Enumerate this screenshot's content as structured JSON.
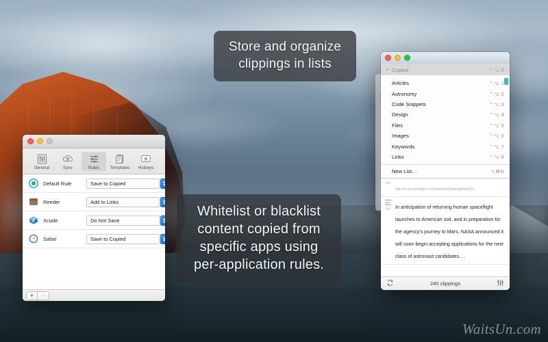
{
  "callouts": {
    "top": {
      "line1": "Store and organize",
      "line2": "clippings in lists"
    },
    "bottom": {
      "line1": "Whitelist or blacklist",
      "line2": "content copied from",
      "line3": "specific apps using",
      "line4": "per-application rules."
    }
  },
  "preferences": {
    "toolbar": [
      {
        "label": "General",
        "icon": "sliders-icon",
        "selected": false
      },
      {
        "label": "Sync",
        "icon": "cloud-icon",
        "selected": false
      },
      {
        "label": "Rules",
        "icon": "rules-icon",
        "selected": true
      },
      {
        "label": "Templates",
        "icon": "document-icon",
        "selected": false
      },
      {
        "label": "Hotkeys",
        "icon": "keyboard-icon",
        "selected": false
      }
    ],
    "rules": [
      {
        "name": "Default Rule",
        "action": "Save to Copied",
        "icon": "target-icon",
        "color": "#1aada0"
      },
      {
        "name": "Reeder",
        "action": "Add to Links",
        "icon": "reeder-icon",
        "color": "#8d7153"
      },
      {
        "name": "Xcode",
        "action": "Do Not Save",
        "icon": "xcode-icon",
        "color": "#4da2e8"
      },
      {
        "name": "Safari",
        "action": "Save to Copied",
        "icon": "safari-icon",
        "color": "#3d84d8"
      }
    ],
    "bottom_bar": {
      "add_label": "+",
      "remove_label": "−"
    }
  },
  "clip_panel": {
    "menu": {
      "header": {
        "label": "Copied",
        "shortcut": "⌃⌥ 0",
        "check": "✓"
      },
      "items": [
        {
          "label": "Articles",
          "shortcut": "⌃⌥ 1"
        },
        {
          "label": "Astronomy",
          "shortcut": "⌃⌥ 2"
        },
        {
          "label": "Code Snippets",
          "shortcut": "⌃⌥ 3"
        },
        {
          "label": "Design",
          "shortcut": "⌃⌥ 4"
        },
        {
          "label": "Files",
          "shortcut": "⌃⌥ 5"
        },
        {
          "label": "Images",
          "shortcut": "⌃⌥ 6"
        },
        {
          "label": "Keywords",
          "shortcut": "⌃⌥ 7"
        },
        {
          "label": "Links",
          "shortcut": "⌃⌥ 8"
        }
      ],
      "new_list": {
        "label": "New List…",
        "shortcut": "⇧⌘N"
      }
    },
    "clippings": [
      {
        "time": "5m",
        "type": "image",
        "url": "http://scienceblogs.com/startswithabang/files/20…"
      },
      {
        "time": "5m",
        "type": "text",
        "text": "In anticipation of returning human spaceflight launches to American soil, and in preparation for the agency's journey to Mars, NASA announced it will soon begin accepting applications for the next class of astronaut candidates…."
      }
    ],
    "status": {
      "refresh_icon": "refresh-icon",
      "count_label": "240 clippings",
      "settings_icon": "sliders-icon"
    }
  },
  "watermark": {
    "text": "WaitsUn.com"
  },
  "colors": {
    "accent_blue": "#1b7fe8",
    "teal": "#1aada0",
    "menu_header_bg": "#d9d9d9"
  }
}
